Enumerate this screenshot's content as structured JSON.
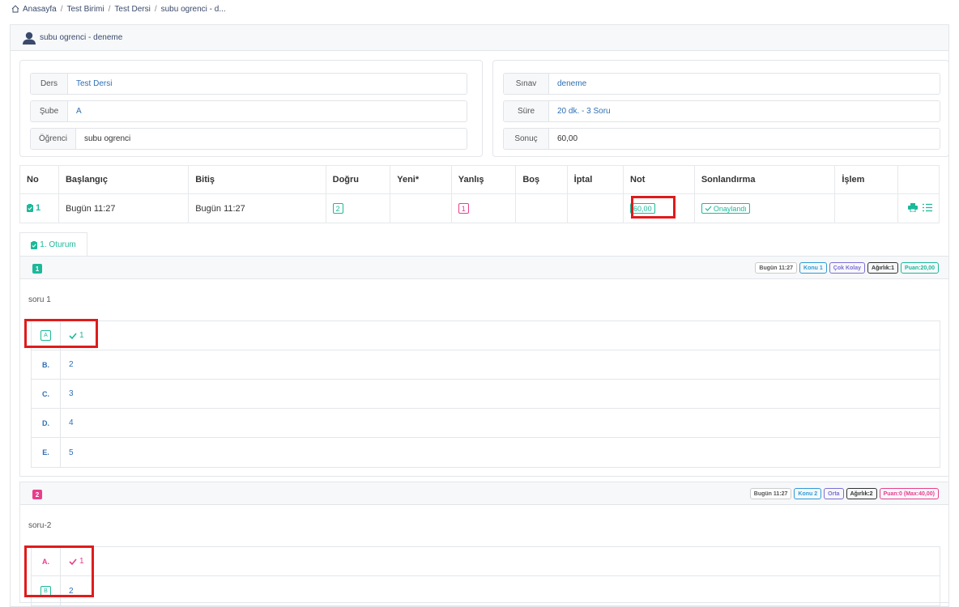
{
  "breadcrumb": [
    "Anasayfa",
    "Test Birimi",
    "Test Dersi",
    "subu ogrenci - d..."
  ],
  "header": {
    "title": "subu ogrenci - deneme"
  },
  "info_left": [
    {
      "label": "Ders",
      "value": "Test Dersi"
    },
    {
      "label": "Şube",
      "value": "A"
    },
    {
      "label": "Öğrenci",
      "value": "subu ogrenci"
    }
  ],
  "info_right": [
    {
      "label": "Sınav",
      "value": "deneme"
    },
    {
      "label": "Süre",
      "value": "20 dk. - 3 Soru"
    },
    {
      "label": "Sonuç",
      "value": "60,00"
    }
  ],
  "table": {
    "headers": [
      "No",
      "Başlangıç",
      "Bitiş",
      "Doğru",
      "Yeni*",
      "Yanlış",
      "Boş",
      "İptal",
      "Not",
      "Sonlandırma",
      "İşlem",
      ""
    ],
    "row": {
      "no": "1",
      "start": "Bugün 11:27",
      "end": "Bugün 11:27",
      "correct": "2",
      "new": "",
      "wrong": "1",
      "empty": "",
      "cancel": "",
      "grade": "60,00",
      "status": "Onaylandı",
      "action": ""
    }
  },
  "tab": {
    "label": "1. Oturum"
  },
  "questions": [
    {
      "num": "1",
      "text": "soru 1",
      "tags": [
        "Bugün 11:27",
        "Konu 1",
        "Çok Kolay",
        "Ağırlık:1",
        "Puan:20,00"
      ],
      "options": [
        {
          "letter": "A",
          "text": "1",
          "selected": true,
          "correct": true
        },
        {
          "letter": "B.",
          "text": "2"
        },
        {
          "letter": "C.",
          "text": "3"
        },
        {
          "letter": "D.",
          "text": "4"
        },
        {
          "letter": "E.",
          "text": "5"
        }
      ]
    },
    {
      "num": "2",
      "text": "soru-2",
      "tags": [
        "Bugün 11:27",
        "Konu 2",
        "Orta",
        "Ağırlık:2",
        "Puan:0 (Max:40,00)"
      ],
      "options": [
        {
          "letter": "A.",
          "text": "1",
          "wrong_mark": true
        },
        {
          "letter": "B",
          "text": "2",
          "selected": true
        }
      ]
    }
  ],
  "colors": {
    "accent": "#1bb99a",
    "pink": "#e83e8c",
    "link": "#2f6fb5",
    "highlight": "#e01b1b"
  }
}
